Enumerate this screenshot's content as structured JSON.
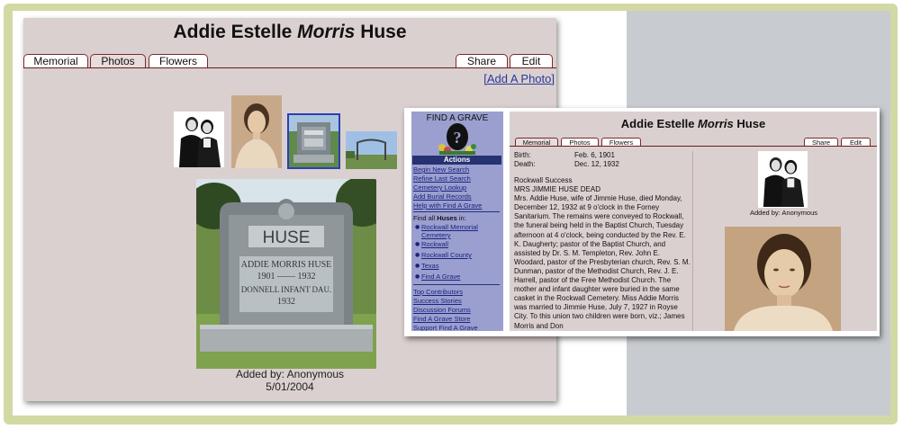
{
  "memorial": {
    "name_first": "Addie Estelle ",
    "name_italic": "Morris",
    "name_last": " Huse"
  },
  "tabs": {
    "memorial": "Memorial",
    "photos": "Photos",
    "flowers": "Flowers",
    "share": "Share",
    "edit": "Edit"
  },
  "photos_page": {
    "add_photo": "[Add A Photo]",
    "added_by": "Added by: Anonymous",
    "added_date": "5/01/2004"
  },
  "headstone": {
    "surname": "HUSE",
    "line1": "ADDIE MORRIS HUSE",
    "line2": "1901 —— 1932",
    "line3": "DONNELL INFANT DAU.",
    "line4": "1932"
  },
  "sidebar": {
    "logo": "FIND A GRAVE",
    "actions_header": "Actions",
    "links": [
      "Begin New Search",
      "Refine Last Search",
      "Cemetery Lookup",
      "Add Burial Records",
      "Help with Find A Grave"
    ],
    "find_all_prefix": "Find all ",
    "find_all_bold": "Huses",
    "find_all_suffix": " in:",
    "find_list": [
      "Rockwall Memorial Cemetery",
      "Rockwall",
      "Rockwall County",
      "Texas",
      "Find A Grave"
    ],
    "bottom_links": [
      "Top Contributors",
      "Success Stories",
      "Discussion Forums",
      "Find A Grave Store",
      "Support Find A Grave"
    ]
  },
  "details": {
    "birth_label": "Birth:",
    "birth_value": "Feb. 6, 1901",
    "death_label": "Death:",
    "death_value": "Dec. 12, 1932",
    "obituary": "Rockwall Success\nMRS JIMMIE HUSE DEAD\nMrs. Addie Huse, wife of Jimmie Huse, died Monday, December 12, 1932 at 9 o'clock in the Forney Sanitarium. The remains were conveyed to Rockwall, the funeral being held in the Baptist Church, Tuesday afternoon at 4 o'clock, being conducted by the Rev. E. K. Daugherty; pastor of the Baptist Church, and assisted by Dr. S. M. Templeton, Rev. John E. Woodard, pastor of the Presbyterian church, Rev. S. M. Dunman, pastor of the Methodist Church, Rev. J. E. Harrell, pastor of the Free Methodist Church. The mother and infant daughter were buried in the same casket in the Rockwall Cemetery. Miss Addie Morris was married to Jimmie Huse, July 7, 1927 in Royse City. To this union two children were born, viz.; James Morris and Don",
    "added_by": "Added by: Anonymous"
  },
  "colors": {
    "panel_bg": "#dbd0d0",
    "tab_border": "#7a2b2b",
    "sidebar_bg": "#9b9fcf",
    "actions_bg": "#263271",
    "link": "#1a237e"
  }
}
